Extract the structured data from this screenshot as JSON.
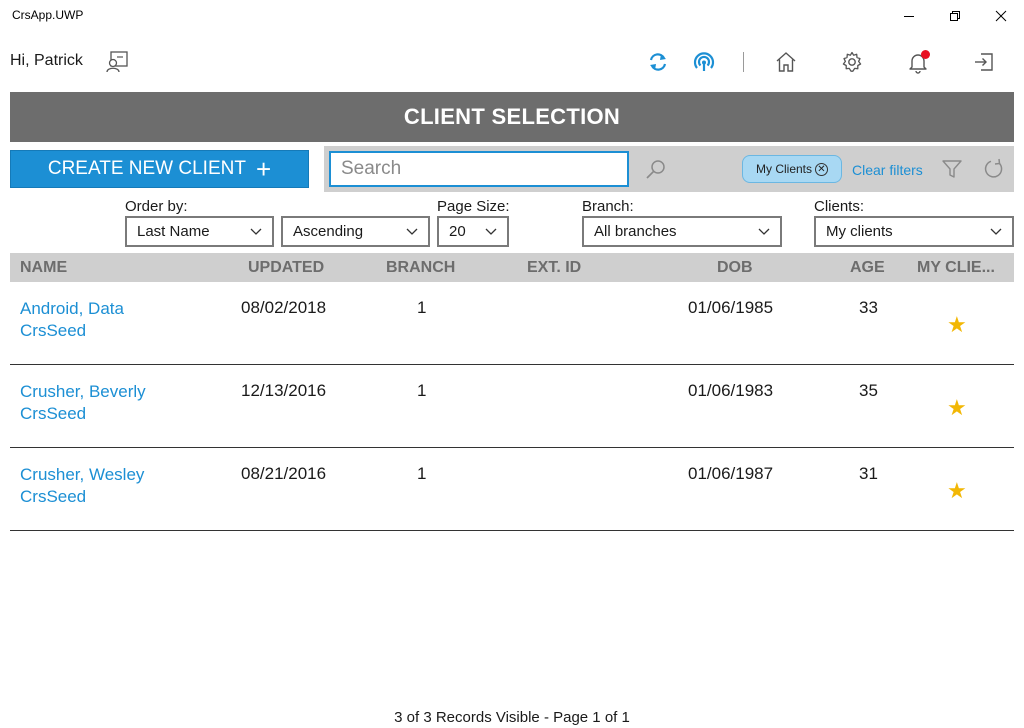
{
  "window": {
    "title": "CrsApp.UWP"
  },
  "header": {
    "greeting": "Hi, Patrick",
    "icons": [
      "profile-switch-icon",
      "sync-icon",
      "broadcast-icon",
      "home-icon",
      "gear-icon",
      "bell-icon",
      "logout-icon"
    ],
    "accent_color": "#1c8fd4",
    "notification_color": "#e81123"
  },
  "banner": {
    "title": "CLIENT SELECTION",
    "color": "#6d6d6d"
  },
  "create_button": {
    "label": "CREATE NEW CLIENT",
    "plus": "+"
  },
  "search": {
    "placeholder": "Search",
    "value": "",
    "chip_label": "My Clients",
    "chip_close": "✕",
    "clear_filters": "Clear filters"
  },
  "filters": {
    "order_by_label": "Order by:",
    "order_by_value": "Last Name",
    "direction_value": "Ascending",
    "page_size_label": "Page Size:",
    "page_size_value": "20",
    "branch_label": "Branch:",
    "branch_value": "All branches",
    "clients_label": "Clients:",
    "clients_value": "My clients"
  },
  "table": {
    "columns": [
      "NAME",
      "UPDATED",
      "BRANCH",
      "EXT. ID",
      "DOB",
      "AGE",
      "MY CLIE..."
    ],
    "rows": [
      {
        "name": "Android, Data",
        "seed": "CrsSeed",
        "updated": "08/02/2018",
        "branch": "1",
        "ext_id": "",
        "dob": "01/06/1985",
        "age": "33",
        "star": "★"
      },
      {
        "name": "Crusher, Beverly",
        "seed": "CrsSeed",
        "updated": "12/13/2016",
        "branch": "1",
        "ext_id": "",
        "dob": "01/06/1983",
        "age": "35",
        "star": "★"
      },
      {
        "name": "Crusher, Wesley",
        "seed": "CrsSeed",
        "updated": "08/21/2016",
        "branch": "1",
        "ext_id": "",
        "dob": "01/06/1987",
        "age": "31",
        "star": "★"
      }
    ]
  },
  "footer": {
    "text": "3 of  3 Records Visible -  Page 1 of  1"
  }
}
